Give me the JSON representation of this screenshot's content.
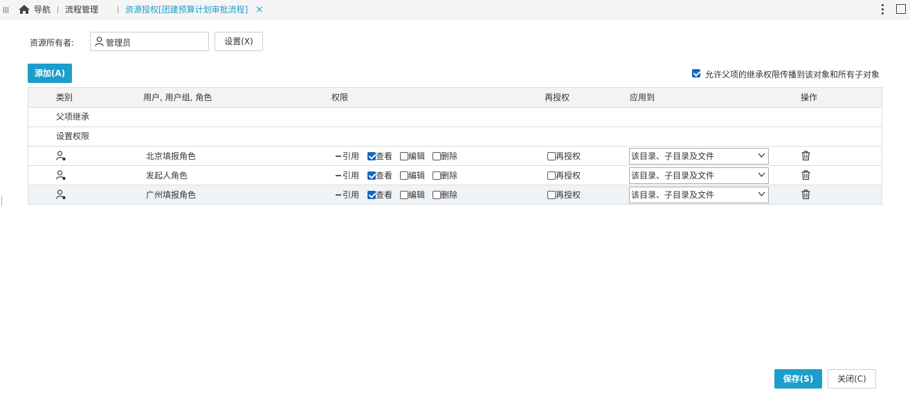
{
  "tabs": {
    "nav_label": "导航",
    "flow_label": "流程管理",
    "active_label": "资源授权[团建预算计划审批流程]",
    "close_glyph": "×"
  },
  "owner": {
    "label": "资源所有者:",
    "value": "管理员",
    "set_button": "设置(X)"
  },
  "toolbar": {
    "add_button": "添加(A)",
    "inherit_checkbox_label": "允许父项的继承权限传播到该对象和所有子对象",
    "inherit_checked": true
  },
  "table": {
    "headers": [
      "类别",
      "用户, 用户组, 角色",
      "权限",
      "再授权",
      "应用到",
      "操作"
    ],
    "group_rows": [
      "父项继承",
      "设置权限"
    ],
    "permission_labels": {
      "ref": "引用",
      "view": "查看",
      "edit": "编辑",
      "delete": "删除",
      "regrant": "再授权"
    },
    "rows": [
      {
        "name": "北京填报角色",
        "view": true,
        "edit": false,
        "delete": false,
        "regrant": false,
        "apply_to": "该目录、子目录及文件"
      },
      {
        "name": "发起人角色",
        "view": true,
        "edit": false,
        "delete": false,
        "regrant": false,
        "apply_to": "该目录、子目录及文件"
      },
      {
        "name": "广州填报角色",
        "view": true,
        "edit": false,
        "delete": false,
        "regrant": false,
        "apply_to": "该目录、子目录及文件"
      }
    ]
  },
  "footer": {
    "save_button": "保存(S)",
    "close_button": "关闭(C)"
  },
  "colors": {
    "accent": "#1b9ecb",
    "checkbox": "#1565c0",
    "active_tab": "#1b9ecb"
  }
}
